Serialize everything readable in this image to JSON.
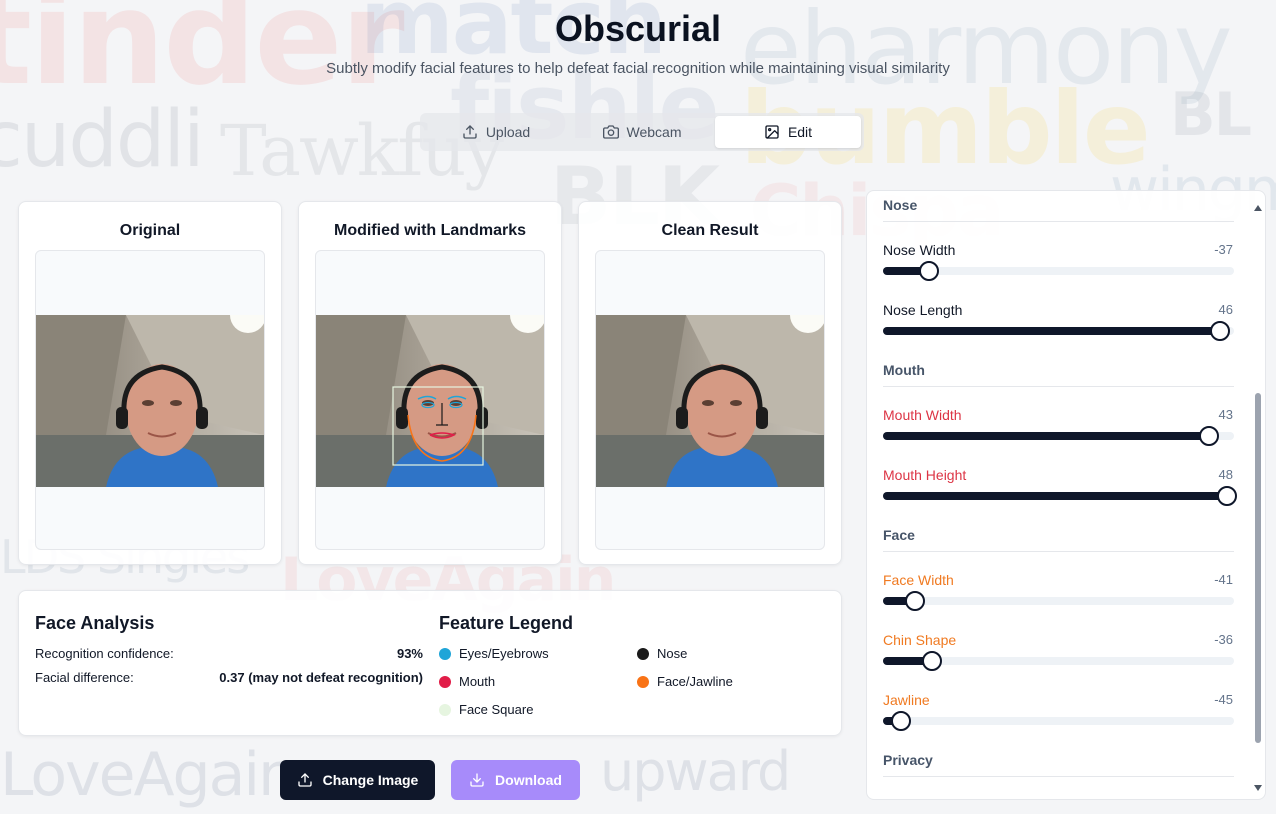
{
  "background_words": [
    "tinder",
    "match",
    "eharmony",
    "cuddli",
    "Tawkfuy",
    "fishle",
    "bumble",
    "BLK",
    "Chispa",
    "wingman",
    "LDS Singles",
    "LoveAgain",
    "upward",
    "BL"
  ],
  "app": {
    "title": "Obscurial",
    "subtitle": "Subtly modify facial features to help defeat facial recognition while maintaining visual similarity"
  },
  "tabs": [
    {
      "label": "Upload",
      "icon": "upload-icon",
      "active": false
    },
    {
      "label": "Webcam",
      "icon": "camera-icon",
      "active": false
    },
    {
      "label": "Edit",
      "icon": "image-icon",
      "active": true
    }
  ],
  "image_cards": [
    {
      "title": "Original"
    },
    {
      "title": "Modified with Landmarks"
    },
    {
      "title": "Clean Result"
    }
  ],
  "analysis": {
    "title": "Face Analysis",
    "rows": [
      {
        "label": "Recognition confidence:",
        "value": "93%"
      },
      {
        "label": "Facial difference:",
        "value": "0.37 (may not defeat recognition)"
      }
    ]
  },
  "legend": {
    "title": "Feature Legend",
    "items": [
      {
        "label": "Eyes/Eyebrows",
        "color": "#1fa5d8"
      },
      {
        "label": "Nose",
        "color": "#1a1a1a"
      },
      {
        "label": "Mouth",
        "color": "#e11d48"
      },
      {
        "label": "Face/Jawline",
        "color": "#f97316"
      },
      {
        "label": "Face Square",
        "color": "#e6f5e0"
      }
    ]
  },
  "buttons": {
    "change_image": "Change Image",
    "download": "Download"
  },
  "panel": {
    "sections": {
      "nose": "Nose",
      "mouth": "Mouth",
      "face": "Face",
      "privacy": "Privacy"
    },
    "sliders": [
      {
        "label": "Nose Width",
        "value": "-37",
        "level": -37,
        "color": "#111827"
      },
      {
        "label": "Nose Length",
        "value": "46",
        "level": 46,
        "color": "#111827"
      },
      {
        "label": "Mouth Width",
        "value": "43",
        "level": 43,
        "color": "#dc3545"
      },
      {
        "label": "Mouth Height",
        "value": "48",
        "level": 48,
        "color": "#dc3545"
      },
      {
        "label": "Face Width",
        "value": "-41",
        "level": -41,
        "color": "#f07a21"
      },
      {
        "label": "Chin Shape",
        "value": "-36",
        "level": -36,
        "color": "#f07a21"
      },
      {
        "label": "Jawline",
        "value": "-45",
        "level": -45,
        "color": "#f07a21"
      }
    ],
    "slider_range": [
      -50,
      50
    ]
  }
}
